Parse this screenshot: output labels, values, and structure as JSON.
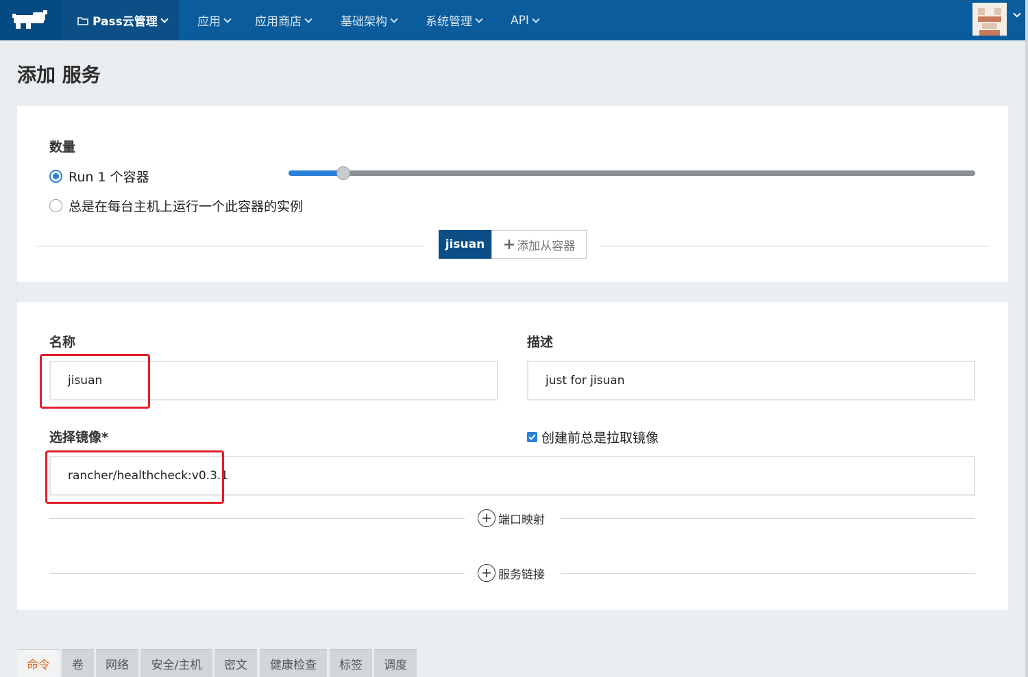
{
  "nav": {
    "env_label": "Pass云管理",
    "items": [
      {
        "label": "应用"
      },
      {
        "label": "应用商店"
      },
      {
        "label": "基础架构"
      },
      {
        "label": "系统管理"
      },
      {
        "label": "API"
      }
    ]
  },
  "page": {
    "title": "添加 服务"
  },
  "scale": {
    "label": "数量",
    "option_run": "Run 1 个容器",
    "option_always": "总是在每台主机上运行一个此容器的实例",
    "slider_fraction": 0.08
  },
  "container_tabs": {
    "active": "jisuan",
    "add_label": "添加从容器"
  },
  "form": {
    "name_label": "名称",
    "name_value": "jisuan",
    "desc_label": "描述",
    "desc_value": "just for jisuan",
    "image_label": "选择镜像*",
    "image_value": "rancher/healthcheck:v0.3.1",
    "pull_label": "创建前总是拉取镜像",
    "port_mapping": "端口映射",
    "service_links": "服务链接"
  },
  "bottom_tabs": [
    "命令",
    "卷",
    "网络",
    "安全/主机",
    "密文",
    "健康检查",
    "标签",
    "调度"
  ],
  "colors": {
    "nav": "#0a5c9c",
    "accent": "#2a7fd8",
    "highlight": "#e11d2a",
    "active_tab_text": "#e0651e"
  }
}
